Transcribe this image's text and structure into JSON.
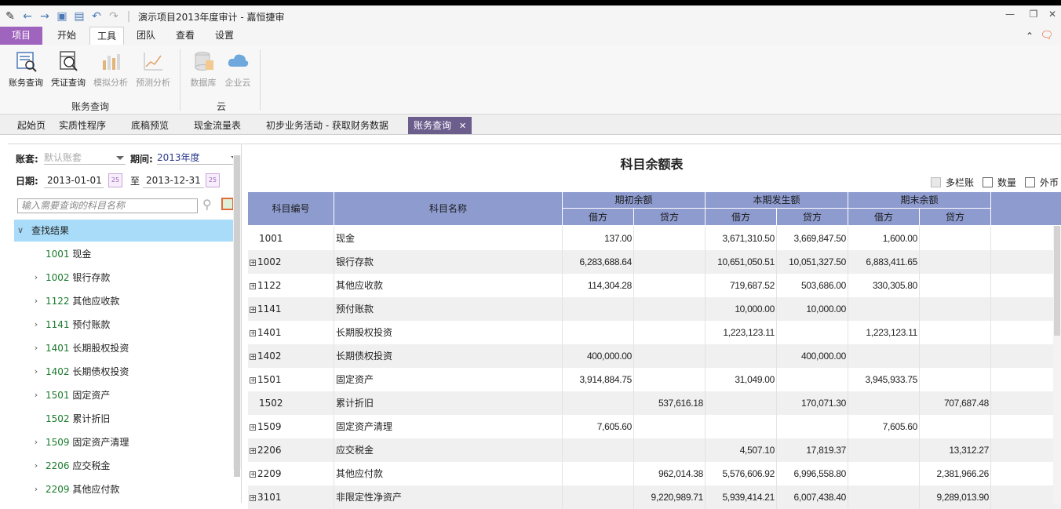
{
  "window": {
    "title": "演示项目2013年度审计 - 嘉恒捷审",
    "controls": [
      "—",
      "❐",
      "✕"
    ]
  },
  "ribbon_tabs": [
    "项目",
    "开始",
    "工具",
    "团队",
    "查看",
    "设置"
  ],
  "ribbon": {
    "groups": [
      {
        "label": "账务查询",
        "buttons": [
          "账务查询",
          "凭证查询",
          "模拟分析",
          "预测分析"
        ]
      },
      {
        "label": "云",
        "buttons": [
          "数据库",
          "企业云"
        ]
      }
    ]
  },
  "doc_tabs": [
    "起始页",
    "实质性程序",
    "底稿预览",
    "现金流量表",
    "初步业务活动 - 获取财务数据",
    "账务查询"
  ],
  "filter": {
    "account_label": "账套:",
    "account_value": "默认账套",
    "period_label": "期间:",
    "period_value": "2013年度",
    "date_label": "日期:",
    "date_from": "2013-01-01",
    "to_label": "至",
    "date_to": "2013-12-31",
    "calendar_day": "25",
    "search_placeholder": "输入需要查询的科目名称"
  },
  "tree": {
    "root": "查找结果",
    "items": [
      {
        "code": "1001",
        "name": "现金",
        "expandable": false
      },
      {
        "code": "1002",
        "name": "银行存款",
        "expandable": true
      },
      {
        "code": "1122",
        "name": "其他应收款",
        "expandable": true
      },
      {
        "code": "1141",
        "name": "预付账款",
        "expandable": true
      },
      {
        "code": "1401",
        "name": "长期股权投资",
        "expandable": true
      },
      {
        "code": "1402",
        "name": "长期债权投资",
        "expandable": true
      },
      {
        "code": "1501",
        "name": "固定资产",
        "expandable": true
      },
      {
        "code": "1502",
        "name": "累计折旧",
        "expandable": false
      },
      {
        "code": "1509",
        "name": "固定资产清理",
        "expandable": true
      },
      {
        "code": "2206",
        "name": "应交税金",
        "expandable": true
      },
      {
        "code": "2209",
        "name": "其他应付款",
        "expandable": true
      }
    ]
  },
  "report": {
    "title": "科目余额表",
    "options": [
      "多栏账",
      "数量",
      "外币"
    ],
    "headers": {
      "code": "科目编号",
      "name": "科目名称",
      "groups": [
        "期初余额",
        "本期发生额",
        "期末余额"
      ],
      "sub": [
        "借方",
        "贷方"
      ]
    },
    "rows": [
      {
        "code": "1001",
        "expand": false,
        "name": "现金",
        "v": [
          "137.00",
          "",
          "3,671,310.50",
          "3,669,847.50",
          "1,600.00",
          ""
        ]
      },
      {
        "code": "1002",
        "expand": true,
        "name": "银行存款",
        "v": [
          "6,283,688.64",
          "",
          "10,651,050.51",
          "10,051,327.50",
          "6,883,411.65",
          ""
        ]
      },
      {
        "code": "1122",
        "expand": true,
        "name": "其他应收款",
        "v": [
          "114,304.28",
          "",
          "719,687.52",
          "503,686.00",
          "330,305.80",
          ""
        ]
      },
      {
        "code": "1141",
        "expand": true,
        "name": "预付账款",
        "v": [
          "",
          "",
          "10,000.00",
          "10,000.00",
          "",
          ""
        ]
      },
      {
        "code": "1401",
        "expand": true,
        "name": "长期股权投资",
        "v": [
          "",
          "",
          "1,223,123.11",
          "",
          "1,223,123.11",
          ""
        ]
      },
      {
        "code": "1402",
        "expand": true,
        "name": "长期债权投资",
        "v": [
          "400,000.00",
          "",
          "",
          "400,000.00",
          "",
          ""
        ]
      },
      {
        "code": "1501",
        "expand": true,
        "name": "固定资产",
        "v": [
          "3,914,884.75",
          "",
          "31,049.00",
          "",
          "3,945,933.75",
          ""
        ]
      },
      {
        "code": "1502",
        "expand": false,
        "name": "累计折旧",
        "v": [
          "",
          "537,616.18",
          "",
          "170,071.30",
          "",
          "707,687.48"
        ]
      },
      {
        "code": "1509",
        "expand": true,
        "name": "固定资产清理",
        "v": [
          "7,605.60",
          "",
          "",
          "",
          "7,605.60",
          ""
        ]
      },
      {
        "code": "2206",
        "expand": true,
        "name": "应交税金",
        "v": [
          "",
          "",
          "4,507.10",
          "17,819.37",
          "",
          "13,312.27"
        ]
      },
      {
        "code": "2209",
        "expand": true,
        "name": "其他应付款",
        "v": [
          "",
          "962,014.38",
          "5,576,606.92",
          "6,996,558.80",
          "",
          "2,381,966.26"
        ]
      },
      {
        "code": "3101",
        "expand": true,
        "name": "非限定性净资产",
        "v": [
          "",
          "9,220,989.71",
          "5,939,414.21",
          "6,007,438.40",
          "",
          "9,289,013.90"
        ]
      }
    ]
  },
  "colors": {
    "accent": "#9f64be",
    "header_bg": "#8e9bcf",
    "active_doctab": "#6b5d8c",
    "selected_tree": "#a8dcf8"
  }
}
